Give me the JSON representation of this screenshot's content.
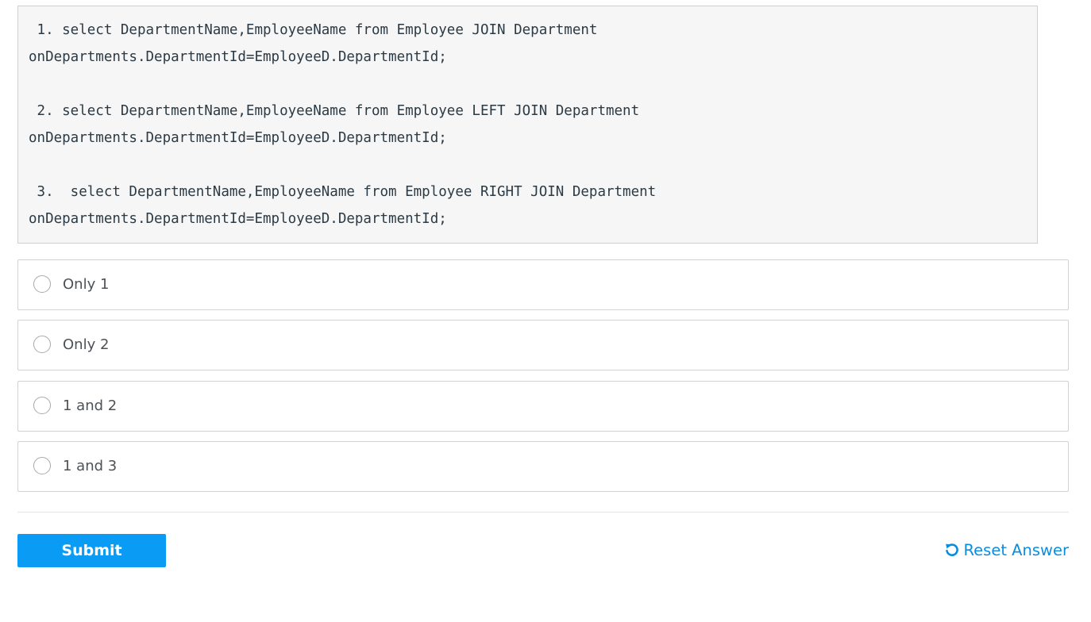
{
  "code": {
    "lines": [
      " 1. select DepartmentName,EmployeeName from Employee JOIN Department",
      "onDepartments.DepartmentId=EmployeeD.DepartmentId;",
      " 2. select DepartmentName,EmployeeName from Employee LEFT JOIN Department",
      "onDepartments.DepartmentId=EmployeeD.DepartmentId;",
      " 3.  select DepartmentName,EmployeeName from Employee RIGHT JOIN Department",
      "onDepartments.DepartmentId=EmployeeD.DepartmentId;"
    ]
  },
  "options": [
    {
      "label": "Only 1",
      "selected": false
    },
    {
      "label": "Only 2",
      "selected": false
    },
    {
      "label": "1 and 2",
      "selected": false
    },
    {
      "label": "1 and 3",
      "selected": false
    }
  ],
  "actions": {
    "submit_label": "Submit",
    "reset_label": "Reset Answer",
    "reset_icon": "reset-icon"
  },
  "colors": {
    "primary": "#0a9bf5",
    "link": "#0a8de0",
    "code_background": "#f6f6f6",
    "option_border": "#d2d2d2"
  }
}
